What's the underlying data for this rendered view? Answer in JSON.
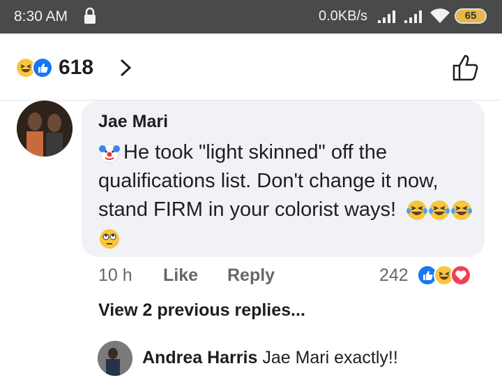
{
  "status": {
    "time": "8:30 AM",
    "speed": "0.0KB/s",
    "battery": "65"
  },
  "header": {
    "reaction_count": "618"
  },
  "comment": {
    "author": "Jae Mari",
    "text_before_emoji": "He took \"light skinned\" off the qualifications list. Don't change it now, stand FIRM in your colorist ways!",
    "time": "10 h",
    "like_label": "Like",
    "reply_label": "Reply",
    "reaction_count": "242"
  },
  "view_previous": "View 2 previous replies...",
  "reply": {
    "author": "Andrea Harris",
    "text": "Jae Mari exactly!!"
  },
  "colors": {
    "like_blue": "#1877f2",
    "haha_yellow": "#f7c63d",
    "love_red": "#f33e58",
    "bubble_bg": "#f0f2f5",
    "statusbar": "#4a4a4a"
  }
}
